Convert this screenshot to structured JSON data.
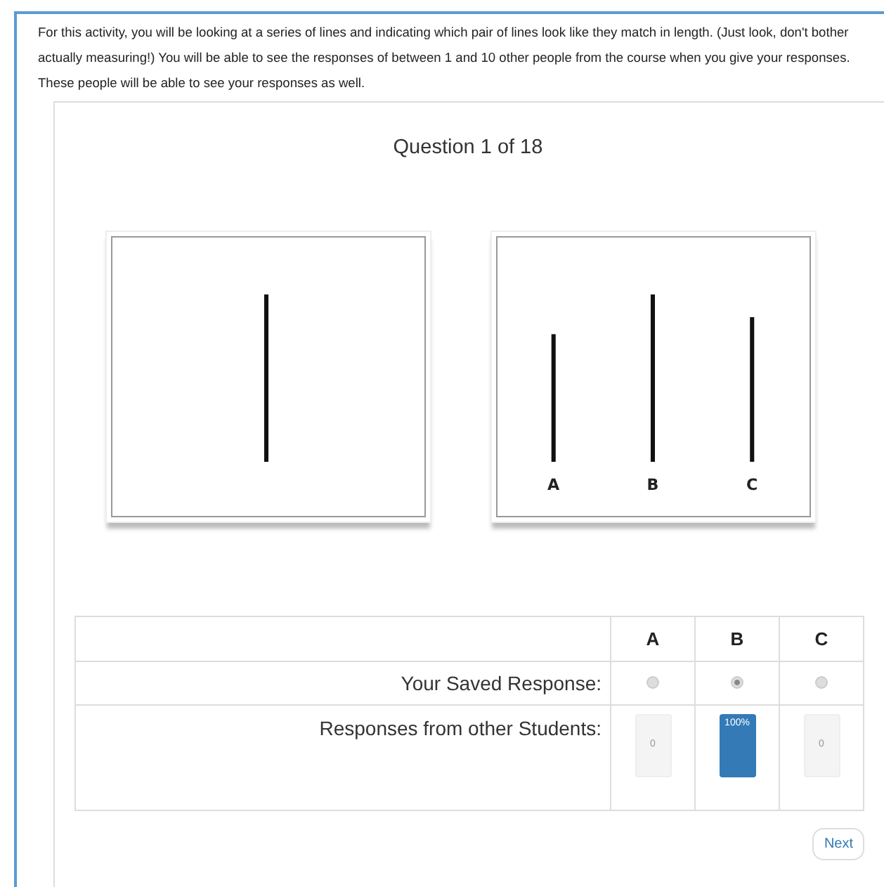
{
  "instructions": "For this activity, you will be looking at a series of lines and indicating which pair of lines look like they match in length. (Just look, don't bother actually measuring!) You will be able to see the responses of between 1 and 10 other people from the course when you give your responses. These people will be able to see your responses as well.",
  "question": "Question 1 of 18",
  "options": [
    {
      "label": "A"
    },
    {
      "label": "B"
    },
    {
      "label": "C"
    }
  ],
  "table": {
    "columns": [
      "A",
      "B",
      "C"
    ],
    "saved_response": {
      "label": "Your Saved Response:",
      "choices": [
        {
          "selected": false
        },
        {
          "selected": true
        },
        {
          "selected": false
        }
      ]
    },
    "other_responses": {
      "label": "Responses from other Students:",
      "bars": [
        {
          "filled": false,
          "text": "0"
        },
        {
          "filled": true,
          "text": "100%"
        },
        {
          "filled": false,
          "text": "0"
        }
      ]
    }
  },
  "next_button": "Next"
}
